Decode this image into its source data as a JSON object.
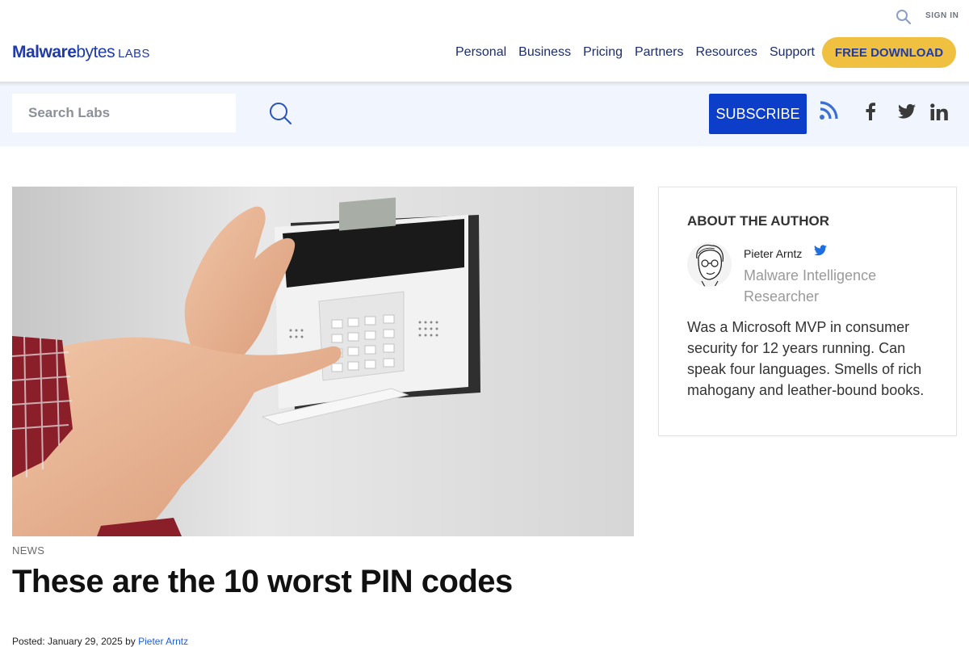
{
  "utility": {
    "signin_label": "SIGN IN"
  },
  "logo": {
    "main_bold": "Malware",
    "main_light": "bytes",
    "suffix": "LABS"
  },
  "nav": {
    "items": [
      "Personal",
      "Business",
      "Pricing",
      "Partners",
      "Resources",
      "Support"
    ],
    "cta_label": "FREE DOWNLOAD"
  },
  "labs_bar": {
    "search_placeholder": "Search Labs",
    "subscribe_label": "SUBSCRIBE",
    "social_icons": [
      "rss-icon",
      "facebook-icon",
      "twitter-icon",
      "linkedin-icon"
    ]
  },
  "article": {
    "category": "NEWS",
    "title": "These are the 10 worst PIN codes",
    "posted_prefix": "Posted: January 29, 2025 by ",
    "author_link": "Pieter Arntz"
  },
  "author": {
    "heading": "ABOUT THE AUTHOR",
    "name": "Pieter Arntz",
    "role": "Malware Intelligence Researcher",
    "bio": "Was a Microsoft MVP in consumer security for 12 years running. Can speak four languages. Smells of rich mahogany and leather-bound books."
  },
  "colors": {
    "brand_blue": "#1f3ba8",
    "subscribe_blue": "#0d3ec9",
    "cta_yellow": "#f0c040",
    "labs_bar_bg": "#f1f5fd",
    "link_blue": "#1f5fd6"
  }
}
